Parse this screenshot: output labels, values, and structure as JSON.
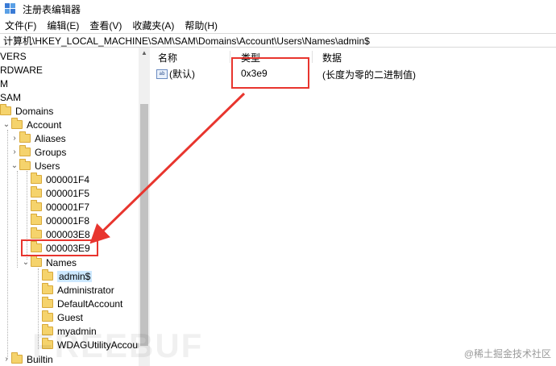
{
  "window": {
    "title": "注册表编辑器"
  },
  "menu": [
    "文件(F)",
    "编辑(E)",
    "查看(V)",
    "收藏夹(A)",
    "帮助(H)"
  ],
  "address": "计算机\\HKEY_LOCAL_MACHINE\\SAM\\SAM\\Domains\\Account\\Users\\Names\\admin$",
  "tree": {
    "top_partial": [
      "VERS",
      "RDWARE",
      "M",
      "SAM"
    ],
    "domains": "Domains",
    "account": "Account",
    "aliases": "Aliases",
    "groups": "Groups",
    "users": "Users",
    "user_keys": [
      "000001F4",
      "000001F5",
      "000001F7",
      "000001F8",
      "000003E8",
      "000003E9"
    ],
    "names": "Names",
    "name_keys": [
      "admin$",
      "Administrator",
      "DefaultAccount",
      "Guest",
      "myadmin",
      "WDAGUtilityAccount"
    ],
    "builtin": "Builtin"
  },
  "list": {
    "headers": {
      "name": "名称",
      "type": "类型",
      "data": "数据"
    },
    "rows": [
      {
        "icon_text": "ab",
        "name": "(默认)",
        "type": "0x3e9",
        "data": "(长度为零的二进制值)"
      }
    ]
  },
  "watermark": "@稀土掘金技术社区",
  "ghost_text": "FREEBUF",
  "colors": {
    "highlight": "#e8352e",
    "folder": "#f5d36c",
    "selection": "#cce8ff"
  }
}
